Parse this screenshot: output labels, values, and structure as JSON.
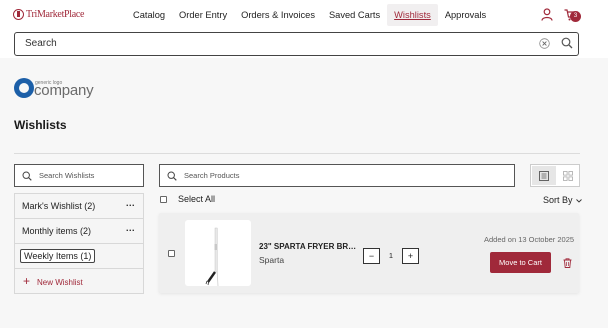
{
  "header": {
    "logo_text": "TriMarketPlace",
    "nav": [
      "Catalog",
      "Order Entry",
      "Orders & Invoices",
      "Saved Carts",
      "Wishlists",
      "Approvals"
    ],
    "active_nav": "Wishlists",
    "cart_count": "3"
  },
  "search": {
    "placeholder": "Search"
  },
  "company_logo": {
    "small": "generic logo",
    "big": "company"
  },
  "page": {
    "title": "Wishlists"
  },
  "sidebar": {
    "search_placeholder": "Search Wishlists",
    "items": [
      {
        "label": "Mark's Wishlist (2)",
        "menu": "..."
      },
      {
        "label": "Monthly items (2)",
        "menu": "..."
      },
      {
        "label": "Weekly Items (1)",
        "menu": ""
      }
    ],
    "new_label": "New Wishlist"
  },
  "main": {
    "search_placeholder": "Search Products",
    "select_all_label": "Select All",
    "sort_label": "Sort By",
    "products": [
      {
        "name": "23\" SPARTA FRYER BRUSH",
        "brand": "Sparta",
        "quantity": "1",
        "added": "Added on 13 October 2025",
        "move_label": "Move to Cart"
      }
    ]
  },
  "colors": {
    "brand": "#a0293a",
    "logo_blue": "#1c5fa8"
  }
}
